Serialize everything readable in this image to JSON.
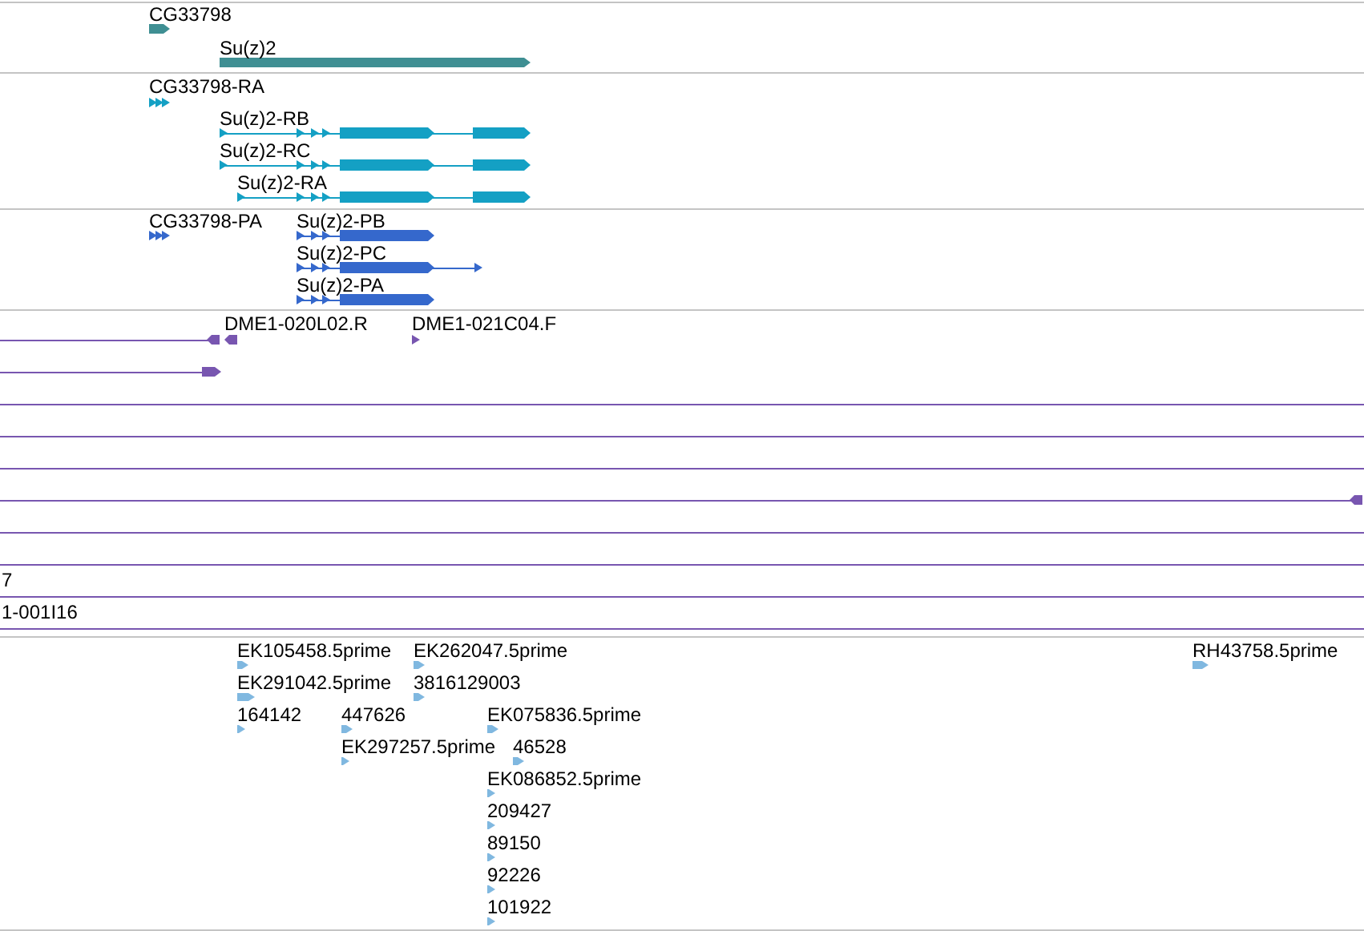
{
  "tracks": [
    {
      "color": "#3f8f93",
      "features": [
        {
          "label": "CG33798"
        },
        {
          "label": "Su(z)2"
        }
      ]
    },
    {
      "color": "#14a0c4",
      "features": [
        {
          "label": "CG33798-RA"
        },
        {
          "label": "Su(z)2-RB"
        },
        {
          "label": "Su(z)2-RC"
        },
        {
          "label": "Su(z)2-RA"
        }
      ]
    },
    {
      "color": "#3568cc",
      "features": [
        {
          "label": "CG33798-PA"
        },
        {
          "label": "Su(z)2-PB"
        },
        {
          "label": "Su(z)2-PC"
        },
        {
          "label": "Su(z)2-PA"
        }
      ]
    },
    {
      "color": "#7856b0",
      "features": [
        {
          "label": "DME1-020L02.R"
        },
        {
          "label": "DME1-021C04.F"
        },
        {
          "label": "7"
        },
        {
          "label": "1-001I16"
        }
      ]
    },
    {
      "color": "#80b8e0",
      "features": [
        {
          "label": "EK105458.5prime"
        },
        {
          "label": "EK262047.5prime"
        },
        {
          "label": "RH43758.5prime"
        },
        {
          "label": "EK291042.5prime"
        },
        {
          "label": "3816129003"
        },
        {
          "label": "164142"
        },
        {
          "label": "447626"
        },
        {
          "label": "EK075836.5prime"
        },
        {
          "label": "EK297257.5prime"
        },
        {
          "label": "46528"
        },
        {
          "label": "EK086852.5prime"
        },
        {
          "label": "209427"
        },
        {
          "label": "89150"
        },
        {
          "label": "92226"
        },
        {
          "label": "101922"
        }
      ]
    }
  ]
}
